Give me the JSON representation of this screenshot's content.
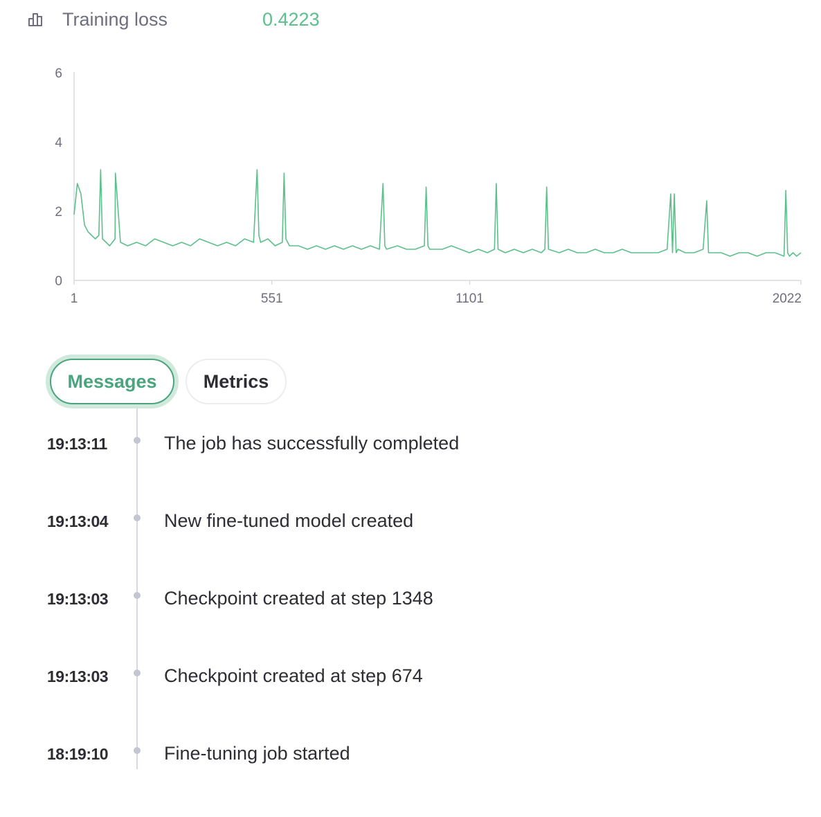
{
  "metric": {
    "icon": "bar-chart-icon",
    "label": "Training loss",
    "value": "0.4223",
    "value_color": "#5cc08a"
  },
  "chart_data": {
    "type": "line",
    "title": "",
    "xlabel": "",
    "ylabel": "",
    "x_ticks": [
      "1",
      "551",
      "1101",
      "2022"
    ],
    "y_ticks": [
      "0",
      "2",
      "4",
      "6"
    ],
    "xlim": [
      1,
      2022
    ],
    "ylim": [
      0,
      6
    ],
    "grid": false,
    "line_color": "#5cc08a",
    "series": [
      {
        "x": [
          1,
          10,
          20,
          30,
          40,
          50,
          60,
          70,
          75,
          80,
          90,
          100,
          115,
          116,
          130,
          150,
          175,
          200,
          225,
          250,
          275,
          300,
          325,
          350,
          375,
          400,
          425,
          450,
          475,
          500,
          510,
          515,
          520,
          540,
          560,
          580,
          585,
          590,
          600,
          625,
          650,
          675,
          700,
          725,
          750,
          775,
          800,
          825,
          850,
          860,
          865,
          870,
          900,
          925,
          950,
          975,
          980,
          985,
          990,
          1000,
          1025,
          1050,
          1075,
          1100,
          1125,
          1150,
          1170,
          1175,
          1180,
          1200,
          1225,
          1250,
          1275,
          1300,
          1310,
          1315,
          1320,
          1350,
          1375,
          1400,
          1425,
          1450,
          1475,
          1500,
          1525,
          1550,
          1575,
          1600,
          1625,
          1650,
          1660,
          1665,
          1670,
          1675,
          1680,
          1700,
          1725,
          1750,
          1760,
          1765,
          1770,
          1800,
          1825,
          1850,
          1875,
          1900,
          1925,
          1950,
          1975,
          1980,
          1985,
          1990,
          2000,
          2010,
          2022
        ],
        "y": [
          1.9,
          2.8,
          2.5,
          1.6,
          1.4,
          1.3,
          1.2,
          1.3,
          3.2,
          1.2,
          1.1,
          1.0,
          1.2,
          3.1,
          1.1,
          1.0,
          1.1,
          1.0,
          1.2,
          1.1,
          1.0,
          1.1,
          1.0,
          1.2,
          1.1,
          1.0,
          1.1,
          1.0,
          1.2,
          1.1,
          3.2,
          1.3,
          1.1,
          1.2,
          1.0,
          1.1,
          3.1,
          1.2,
          1.0,
          1.0,
          0.9,
          1.0,
          0.9,
          1.0,
          0.9,
          1.0,
          0.9,
          1.0,
          0.9,
          2.8,
          1.0,
          0.9,
          1.0,
          0.9,
          0.9,
          1.0,
          2.7,
          1.0,
          0.9,
          0.9,
          0.9,
          1.0,
          0.9,
          0.8,
          0.9,
          0.8,
          0.9,
          2.8,
          0.9,
          0.8,
          0.9,
          0.8,
          0.9,
          0.8,
          0.9,
          2.7,
          0.9,
          0.8,
          0.9,
          0.8,
          0.8,
          0.9,
          0.8,
          0.8,
          0.9,
          0.8,
          0.8,
          0.8,
          0.8,
          0.9,
          2.5,
          0.8,
          2.5,
          0.8,
          0.9,
          0.8,
          0.8,
          0.9,
          2.3,
          0.8,
          0.8,
          0.8,
          0.7,
          0.8,
          0.8,
          0.7,
          0.8,
          0.8,
          0.7,
          2.6,
          0.8,
          0.7,
          0.8,
          0.7,
          0.8
        ]
      }
    ]
  },
  "tabs": {
    "messages": "Messages",
    "metrics": "Metrics"
  },
  "events": [
    {
      "time": "19:13:11",
      "message": "The job has successfully completed"
    },
    {
      "time": "19:13:04",
      "message": "New fine-tuned model created"
    },
    {
      "time": "19:13:03",
      "message": "Checkpoint created at step 1348"
    },
    {
      "time": "19:13:03",
      "message": "Checkpoint created at step 674"
    },
    {
      "time": "18:19:10",
      "message": "Fine-tuning job started"
    }
  ]
}
